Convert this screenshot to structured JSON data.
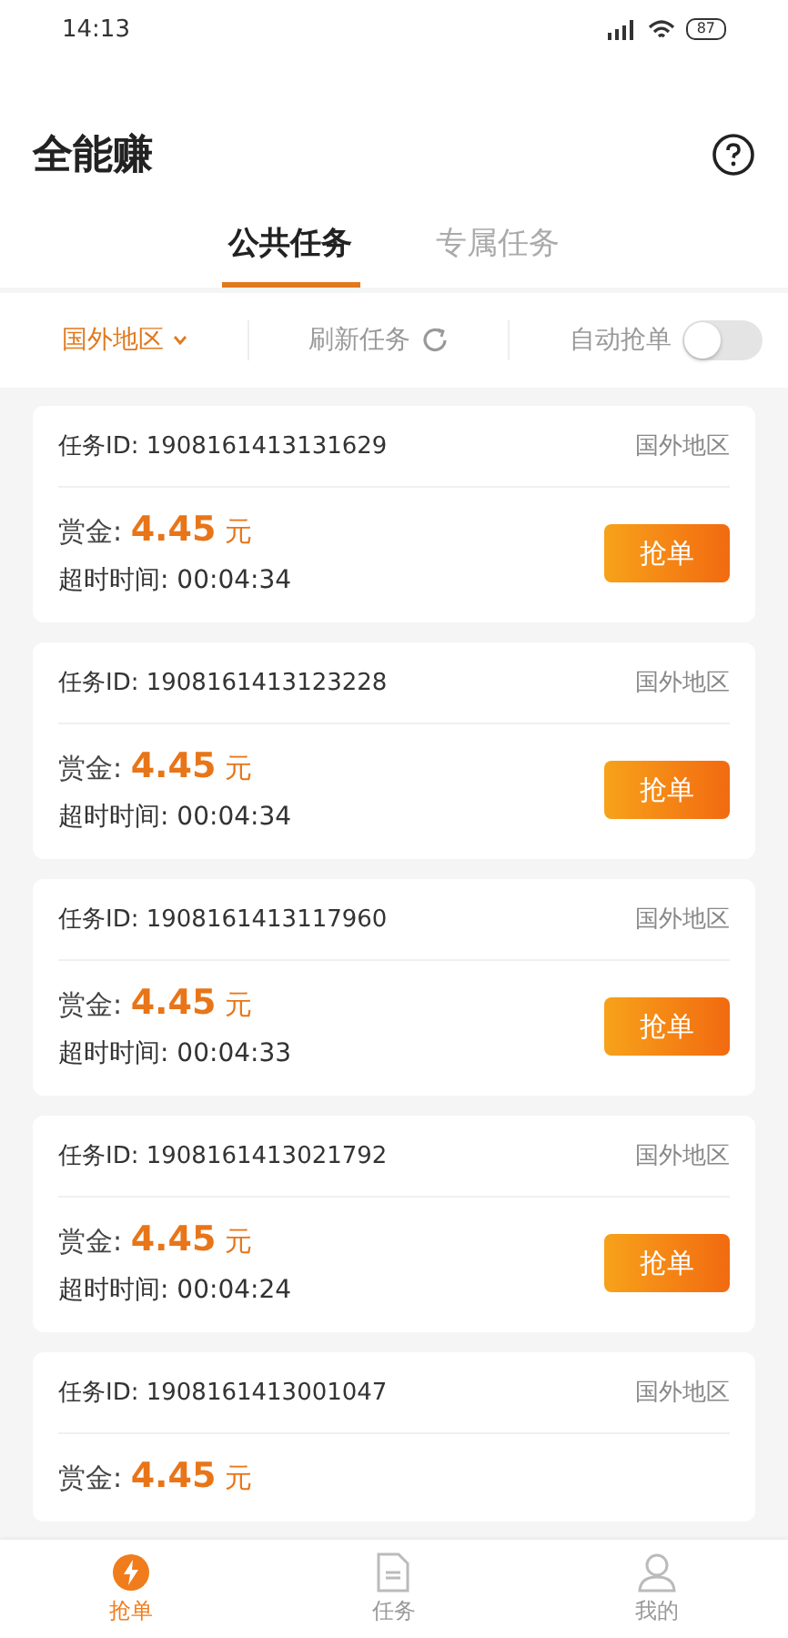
{
  "status_bar": {
    "time": "14:13",
    "battery": "87"
  },
  "header": {
    "title": "全能赚"
  },
  "tabs": [
    {
      "label": "公共任务",
      "selected": true
    },
    {
      "label": "专属任务",
      "selected": false
    }
  ],
  "filters": {
    "region": "国外地区",
    "refresh": "刷新任务",
    "auto_grab": {
      "label": "自动抢单",
      "on": false
    }
  },
  "tasks": [
    {
      "id_label": "任务ID:",
      "id": "1908161413131629",
      "region": "国外地区",
      "reward_label": "赏金:",
      "reward": "4.45",
      "unit": "元",
      "timeout_label": "超时时间:",
      "timeout": "00:04:34",
      "button": "抢单"
    },
    {
      "id_label": "任务ID:",
      "id": "1908161413123228",
      "region": "国外地区",
      "reward_label": "赏金:",
      "reward": "4.45",
      "unit": "元",
      "timeout_label": "超时时间:",
      "timeout": "00:04:34",
      "button": "抢单"
    },
    {
      "id_label": "任务ID:",
      "id": "1908161413117960",
      "region": "国外地区",
      "reward_label": "赏金:",
      "reward": "4.45",
      "unit": "元",
      "timeout_label": "超时时间:",
      "timeout": "00:04:33",
      "button": "抢单"
    },
    {
      "id_label": "任务ID:",
      "id": "1908161413021792",
      "region": "国外地区",
      "reward_label": "赏金:",
      "reward": "4.45",
      "unit": "元",
      "timeout_label": "超时时间:",
      "timeout": "00:04:24",
      "button": "抢单"
    },
    {
      "id_label": "任务ID:",
      "id": "1908161413001047",
      "region": "国外地区",
      "reward_label": "赏金:",
      "reward": "4.45",
      "unit": "元"
    }
  ],
  "bottom_nav": [
    {
      "label": "抢单",
      "kind": "grab",
      "selected": true
    },
    {
      "label": "任务",
      "kind": "tasks",
      "selected": false
    },
    {
      "label": "我的",
      "kind": "profile",
      "selected": false
    }
  ]
}
